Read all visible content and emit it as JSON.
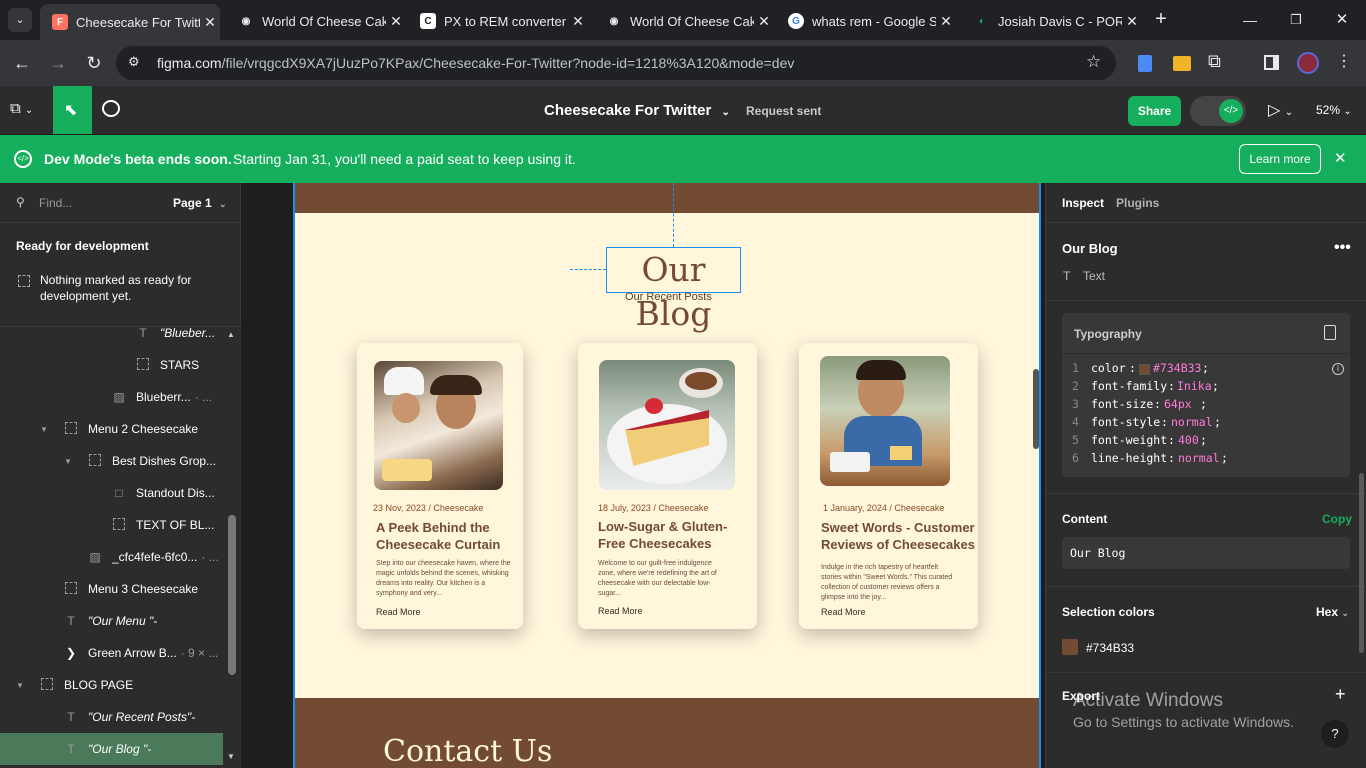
{
  "browser": {
    "tabs": [
      {
        "title": "Cheesecake For Twitte",
        "active": true
      },
      {
        "title": "World Of Cheese Cak",
        "active": false
      },
      {
        "title": "PX to REM converter (",
        "active": false
      },
      {
        "title": "World Of Cheese Cak",
        "active": false
      },
      {
        "title": "whats rem - Google S",
        "active": false
      },
      {
        "title": "Josiah Davis C - PORT",
        "active": false
      }
    ],
    "url_domain": "figma.com",
    "url_path": "/file/vrqgcdX9XA7jUuzPo7KPax/Cheesecake-For-Twitter?node-id=1218%3A120&mode=dev"
  },
  "figma": {
    "file_title": "Cheesecake For Twitter",
    "request_status": "Request sent",
    "share_label": "Share",
    "zoom": "52%"
  },
  "banner": {
    "title": "Dev Mode's beta ends soon.",
    "message": "Starting Jan 31, you'll need a paid seat to keep using it.",
    "button": "Learn more"
  },
  "left": {
    "search_placeholder": "Find...",
    "page": "Page 1",
    "section_title": "Ready for development",
    "empty_message_1": "Nothing marked as ready for",
    "empty_message_2": "development yet.",
    "layers": [
      {
        "label": "\"Blueber...",
        "icon": "text",
        "indent": 3
      },
      {
        "label": "STARS",
        "icon": "frame",
        "indent": 3
      },
      {
        "label": "Blueberr...",
        "suffix": "· ...",
        "icon": "image",
        "indent": 2
      },
      {
        "label": "Menu 2 Cheesecake",
        "icon": "frame",
        "indent": 1,
        "caret": true
      },
      {
        "label": "Best Dishes Grop...",
        "icon": "frame",
        "indent": 2,
        "caret": true
      },
      {
        "label": "Standout Dis...",
        "icon": "rect",
        "indent": 3
      },
      {
        "label": "TEXT OF BL...",
        "icon": "frame",
        "indent": 3
      },
      {
        "label": "_cfc4fefe-6fc0...",
        "suffix": "· ...",
        "icon": "image",
        "indent": 2
      },
      {
        "label": "Menu 3 Cheesecake",
        "icon": "frame",
        "indent": 1
      },
      {
        "label": "\"Our Menu \"-",
        "icon": "text",
        "indent": 1
      },
      {
        "label": "Green Arrow B...",
        "suffix": "· 9 × ...",
        "icon": "arrow",
        "indent": 1
      },
      {
        "label": "BLOG PAGE",
        "icon": "frame",
        "indent": 0,
        "caret": true
      },
      {
        "label": "\"Our Recent Posts\"-",
        "icon": "text",
        "indent": 1
      },
      {
        "label": "\"Our Blog \"-",
        "icon": "text",
        "indent": 1,
        "selected": true
      }
    ]
  },
  "design": {
    "heading": "Our Blog",
    "subheading": "Our Recent Posts",
    "contact": "Contact Us",
    "cards": [
      {
        "meta": "23 Nov, 2023 / Cheesecake",
        "title": "A Peek Behind the Cheesecake Curtain",
        "desc": "Step into our cheesecake haven, where the magic unfolds behind the scenes, whisking dreams into reality. Our kitchen is a symphony and very...",
        "more": "Read More"
      },
      {
        "meta": "18 July, 2023 / Cheesecake",
        "title": "Low-Sugar & Gluten-Free Cheesecakes",
        "desc": "Welcome to our guilt-free indulgence zone, where we're redefining the art of cheesecake with our delectable low-sugar...",
        "more": "Read More"
      },
      {
        "meta": "1 January, 2024 / Cheesecake",
        "title": "Sweet Words - Customer Reviews of Cheesecakes",
        "desc": "Indulge in the rich tapestry of heartfelt stories within \"Sweet Words.\" This curated collection of customer reviews offers a glimpse into the joy...",
        "more": "Read More"
      }
    ]
  },
  "inspect": {
    "tabs": [
      "Inspect",
      "Plugins"
    ],
    "layer_name": "Our Blog",
    "layer_type": "Text",
    "typography_title": "Typography",
    "code": [
      {
        "num": "1",
        "prop": "color",
        "value": "#734B33"
      },
      {
        "num": "2",
        "prop": "font-family",
        "value": "Inika"
      },
      {
        "num": "3",
        "prop": "font-size",
        "value": "64px"
      },
      {
        "num": "4",
        "prop": "font-style",
        "value": "normal"
      },
      {
        "num": "5",
        "prop": "font-weight",
        "value": "400"
      },
      {
        "num": "6",
        "prop": "line-height",
        "value": "normal"
      }
    ],
    "content_title": "Content",
    "copy_label": "Copy",
    "content_value": "Our Blog",
    "selection_colors_title": "Selection colors",
    "color_format": "Hex",
    "selection_color": "#734B33",
    "export_title": "Export"
  },
  "windows": {
    "line1": "Activate Windows",
    "line2": "Go to Settings to activate Windows."
  },
  "colors": {
    "brown": "#734B33",
    "cream": "#FFF6DC",
    "green": "#14AE5C"
  }
}
